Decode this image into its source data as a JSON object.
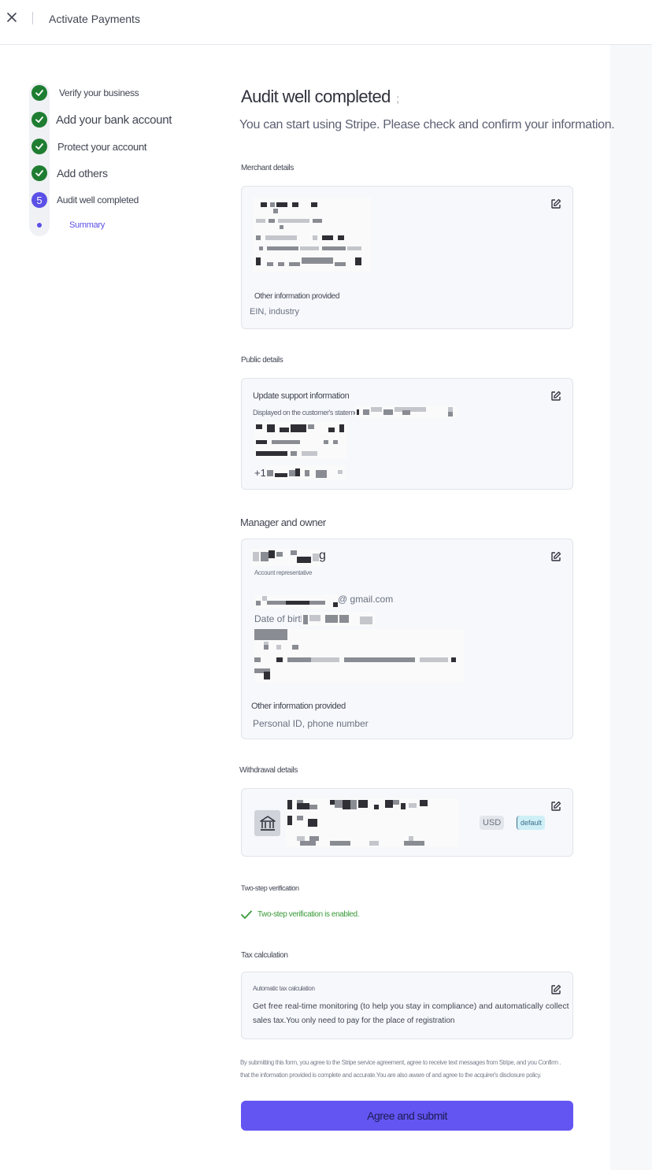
{
  "header": {
    "title": "Activate Payments"
  },
  "steps": [
    {
      "label": "Verify your business",
      "state": "done"
    },
    {
      "label": "Add your bank account",
      "state": "done"
    },
    {
      "label": "Protect your account",
      "state": "done"
    },
    {
      "label": "Add others",
      "state": "done"
    },
    {
      "label": "Audit well completed",
      "state": "current",
      "number": "5"
    },
    {
      "label": "Summary",
      "state": "substep"
    }
  ],
  "main": {
    "title": "Audit well completed",
    "title_suffix": ";",
    "subtitle": "You can start using Stripe. Please check and confirm your information."
  },
  "merchant": {
    "section_label": "Merchant details",
    "other_label": "Other information provided",
    "other_value": "EIN, industry"
  },
  "public": {
    "section_label": "Public details",
    "support_title": "Update support information",
    "statement_label": "Displayed on the customer's statement as",
    "phone_prefix": "+1"
  },
  "owner": {
    "section_label": "Manager and owner",
    "name_suffix": "g",
    "role": "Account representative",
    "email_suffix": "@ gmail.com",
    "dob_label": "Date of birth:",
    "other_label": "Other information provided",
    "other_value": "Personal ID, phone number"
  },
  "withdrawal": {
    "section_label": "Withdrawal details",
    "currency": "USD",
    "default_badge": "default"
  },
  "twostep": {
    "section_label": "Two-step verification",
    "status": "Two-step verification is enabled."
  },
  "tax": {
    "section_label": "Tax calculation",
    "title": "Automatic tax calculation",
    "line1": "Get free real-time monitoring (to help you stay in compliance) and automatically collect",
    "line2": "sales tax.You only need to pay for the place of registration"
  },
  "legal": {
    "line1": "By submitting this form, you agree to the Stripe service agreement, agree to receive text messages from Stripe, and you Confirm .",
    "line2": "that the information provided is complete and accurate.You are also aware of and agree to the acquirer's disclosure policy."
  },
  "submit_label": "Agree and submit",
  "colors": {
    "accent": "#6355f2",
    "success": "#1e7d32",
    "step_number": "#5a4fe6",
    "success_text": "#3a9a3a"
  },
  "icons": {
    "close": "close-icon",
    "check": "check-icon",
    "edit": "edit-icon",
    "bank": "bank-icon"
  }
}
